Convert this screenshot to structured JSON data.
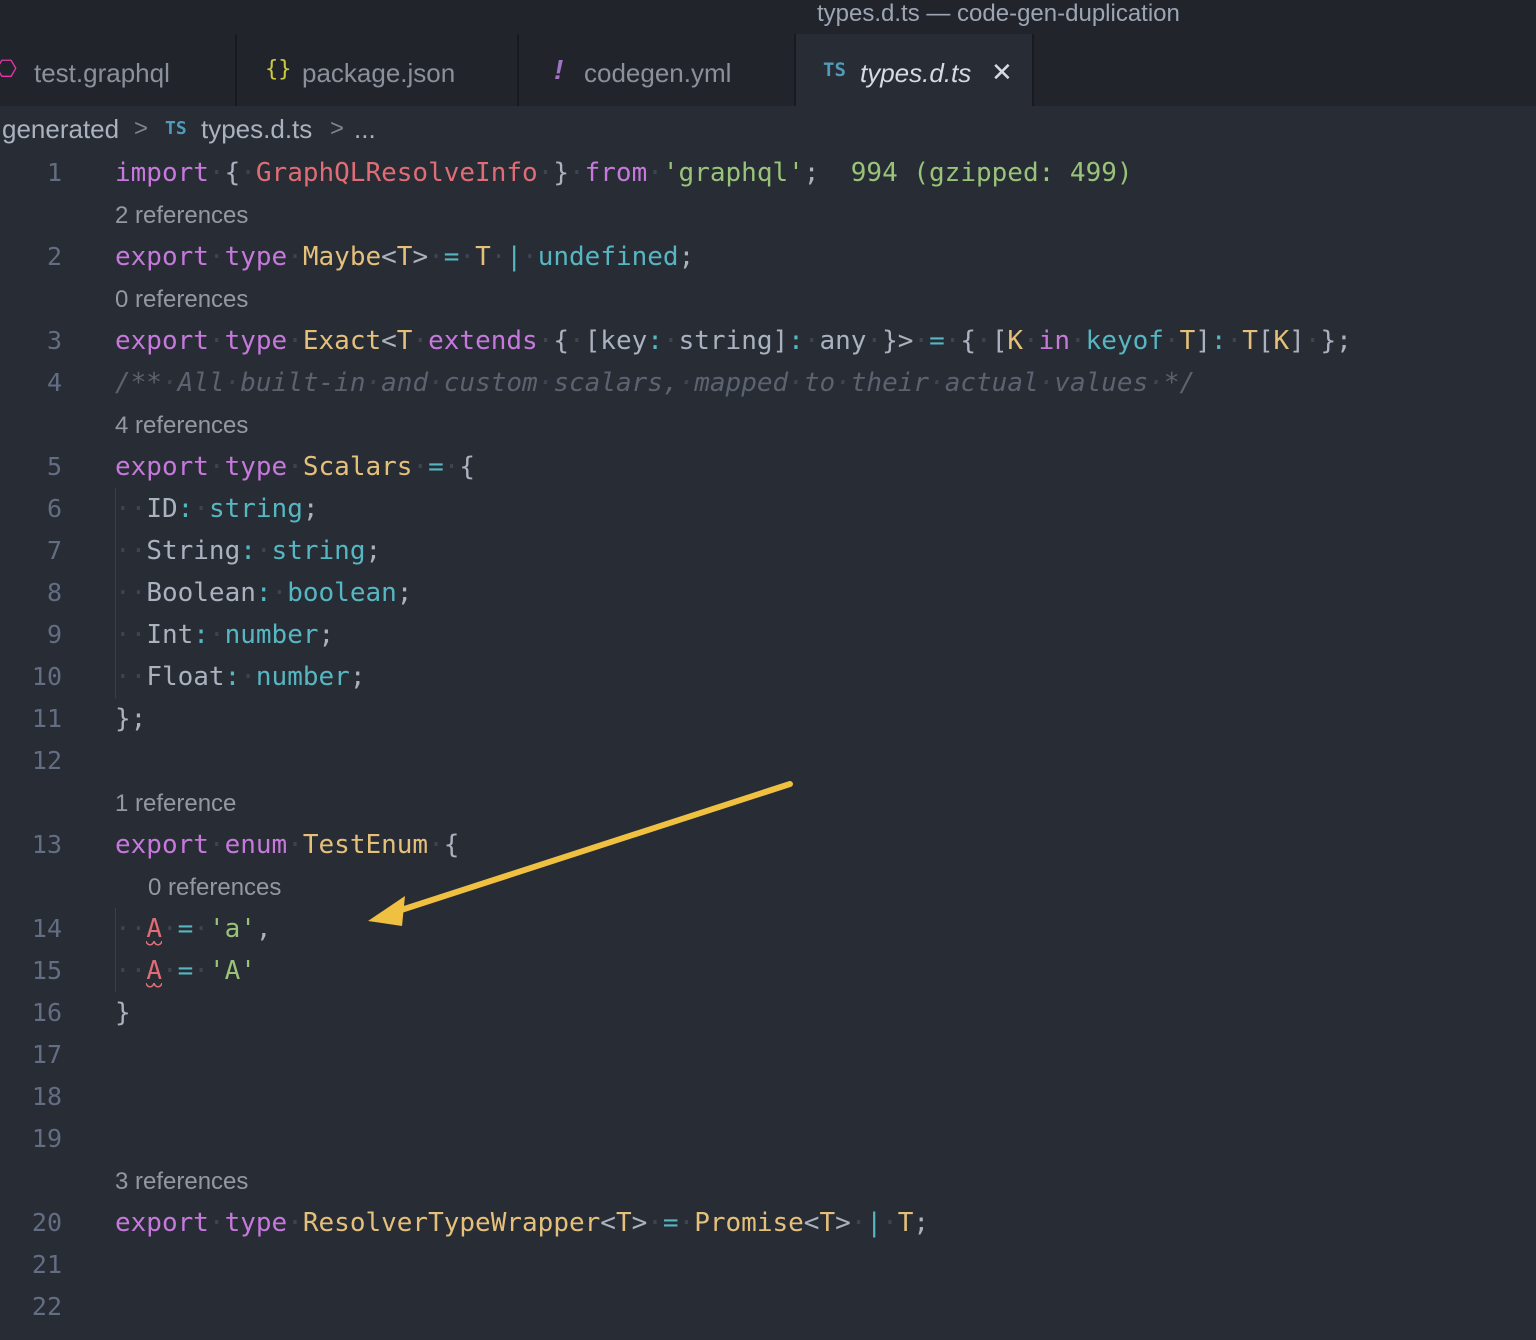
{
  "window": {
    "title": "types.d.ts — code-gen-duplication"
  },
  "tabs": [
    {
      "icon": "graphql-icon",
      "icon_glyph": "⎔",
      "label": "test.graphql",
      "color": "#e535ab"
    },
    {
      "icon": "json-braces-icon",
      "icon_glyph": "{}",
      "label": "package.json",
      "color": "#cbcb41"
    },
    {
      "icon": "yaml-exclamation-icon",
      "icon_glyph": "!",
      "label": "codegen.yml",
      "color": "#a074c4"
    },
    {
      "icon": "typescript-icon",
      "icon_glyph": "TS",
      "label": "types.d.ts",
      "color": "#519aba",
      "active": true,
      "close_glyph": "✕"
    }
  ],
  "breadcrumb": {
    "folder": "generated",
    "sep": ">",
    "file_badge": "TS",
    "file": "types.d.ts",
    "more": "..."
  },
  "codelens": {
    "l2": "2 references",
    "l3": "0 references",
    "l5": "4 references",
    "l13": "1 reference",
    "l14": "0 references",
    "l20": "3 references"
  },
  "import_cost": "994 (gzipped: 499)",
  "line_numbers": [
    "1",
    "2",
    "3",
    "4",
    "5",
    "6",
    "7",
    "8",
    "9",
    "10",
    "11",
    "12",
    "13",
    "14",
    "15",
    "16",
    "17",
    "18",
    "19",
    "20",
    "21",
    "22"
  ],
  "accent": {
    "arrow": "#f0c040",
    "error": "#e06c75"
  }
}
